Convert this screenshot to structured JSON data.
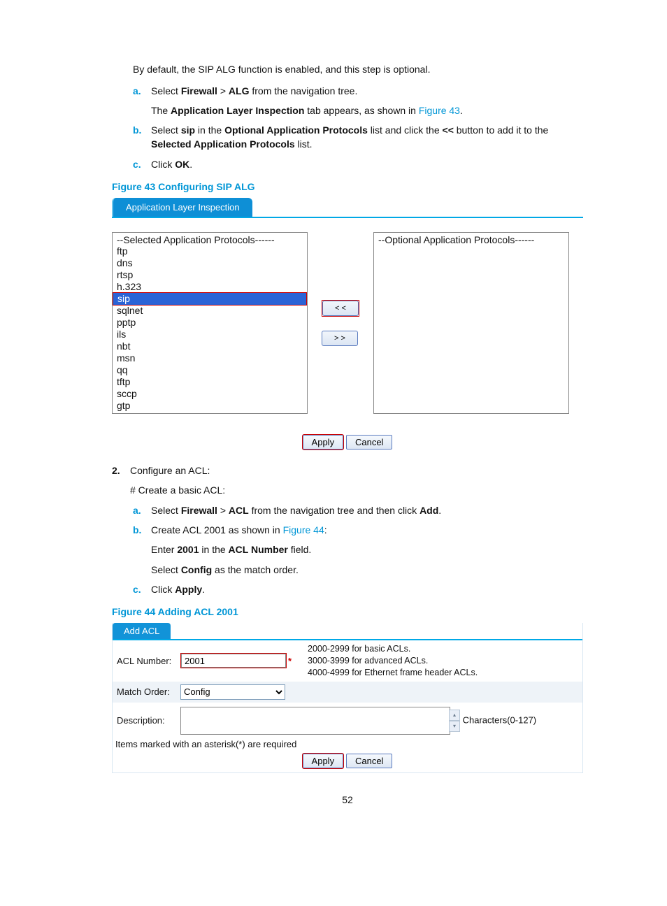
{
  "intro": "By default, the SIP ALG function is enabled, and this step is optional.",
  "steps1": {
    "a": {
      "pre": "Select ",
      "b1": "Firewall",
      "mid": " > ",
      "b2": "ALG",
      "post": " from the navigation tree."
    },
    "a_after": {
      "pre": "The ",
      "b1": "Application Layer Inspection",
      "mid": " tab appears, as shown in ",
      "link": "Figure 43",
      "post": "."
    },
    "b": {
      "pre": "Select ",
      "b1": "sip",
      "mid1": " in the ",
      "b2": "Optional Application Protocols",
      "mid2": " list and click the ",
      "b3": "<<",
      "mid3": " button to add it to the ",
      "b4": "Selected Application Protocols",
      "post": " list."
    },
    "c": {
      "pre": "Click ",
      "b1": "OK",
      "post": "."
    }
  },
  "fig43": {
    "caption": "Figure 43 Configuring SIP ALG",
    "tab": "Application Layer Inspection",
    "left_header": "--Selected Application Protocols------",
    "right_header": "--Optional Application Protocols------",
    "left_items": [
      "ftp",
      "dns",
      "rtsp",
      "h.323",
      "sip",
      "sqlnet",
      "pptp",
      "ils",
      "nbt",
      "msn",
      "qq",
      "tftp",
      "sccp",
      "gtp"
    ],
    "selected": "sip",
    "btn_add": "< <",
    "btn_remove": "> >",
    "apply": "Apply",
    "cancel": "Cancel"
  },
  "step2": {
    "num": "2.",
    "title": "Configure an ACL:",
    "sub": "# Create a basic ACL:",
    "a": {
      "pre": "Select ",
      "b1": "Firewall",
      "mid": " > ",
      "b2": "ACL",
      "mid2": " from the navigation tree and then click ",
      "b3": "Add",
      "post": "."
    },
    "b": {
      "pre": "Create ACL 2001 as shown in ",
      "link": "Figure 44",
      "post": ":"
    },
    "b_l1": {
      "pre": "Enter ",
      "b1": "2001",
      "mid": " in the ",
      "b2": "ACL Number",
      "post": " field."
    },
    "b_l2": {
      "pre": "Select ",
      "b1": "Config",
      "post": " as the match order."
    },
    "c": {
      "pre": "Click ",
      "b1": "Apply",
      "post": "."
    }
  },
  "fig44": {
    "caption": "Figure 44 Adding ACL 2001",
    "tab": "Add ACL",
    "acl_label": "ACL Number:",
    "acl_value": "2001",
    "hint1": "2000-2999 for basic ACLs.",
    "hint2": "3000-3999 for advanced ACLs.",
    "hint3": "4000-4999 for Ethernet frame header ACLs.",
    "match_label": "Match Order:",
    "match_value": "Config",
    "desc_label": "Description:",
    "chars_hint": "Characters(0-127)",
    "req_note": "Items marked with an asterisk(*) are required",
    "apply": "Apply",
    "cancel": "Cancel"
  },
  "pagenum": "52"
}
